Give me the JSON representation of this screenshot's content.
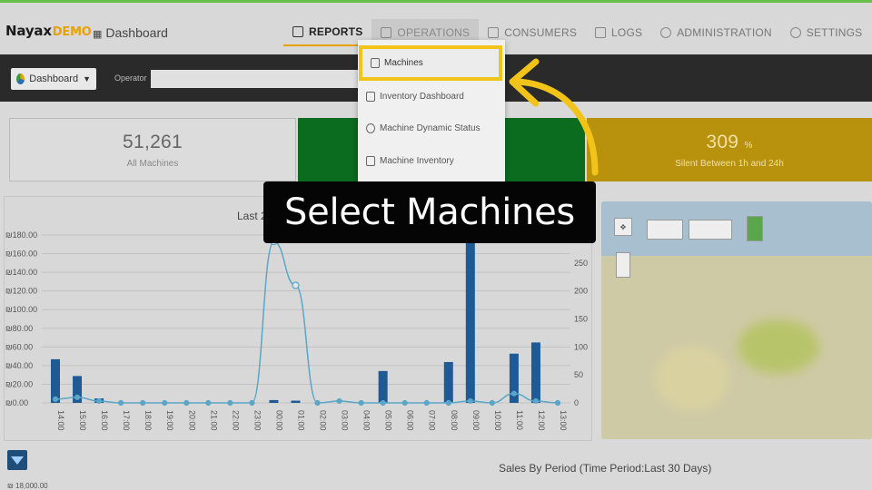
{
  "header": {
    "logo_main": "Nayax",
    "logo_sub": "DEMO",
    "page_name": "Dashboard",
    "nav": [
      {
        "label": "REPORTS",
        "state": "active"
      },
      {
        "label": "OPERATIONS",
        "state": "open"
      },
      {
        "label": "CONSUMERS",
        "state": "normal"
      },
      {
        "label": "LOGS",
        "state": "normal"
      },
      {
        "label": "ADMINISTRATION",
        "state": "normal"
      },
      {
        "label": "SETTINGS",
        "state": "normal"
      }
    ]
  },
  "filter": {
    "dashboard_select": "Dashboard",
    "operator_label": "Operator",
    "operator_value": ""
  },
  "kpis": [
    {
      "value": "51,261",
      "label": "All Machines"
    },
    {
      "value": "",
      "label": ""
    },
    {
      "value": "309",
      "unit": "%",
      "label": "Silent Between 1h and 24h"
    }
  ],
  "dropdown": {
    "items": [
      "Machines",
      "Inventory Dashboard",
      "Machine Dynamic Status",
      "Machine Inventory"
    ],
    "selected": "Machines"
  },
  "chart_data": {
    "type": "bar",
    "title": "Last 2",
    "categories": [
      "14:00",
      "15:00",
      "16:00",
      "17:00",
      "18:00",
      "19:00",
      "20:00",
      "21:00",
      "22:00",
      "23:00",
      "00:00",
      "01:00",
      "02:00",
      "03:00",
      "04:00",
      "05:00",
      "06:00",
      "07:00",
      "08:00",
      "09:00",
      "10:00",
      "11:00",
      "12:00",
      "13:00"
    ],
    "left_axis": {
      "ticks": [
        "₪0.00",
        "₪20.00",
        "₪40.00",
        "₪60.00",
        "₪80.00",
        "₪100.00",
        "₪120.00",
        "₪140.00",
        "₪160.00",
        "₪180.00"
      ],
      "range": [
        0,
        180
      ]
    },
    "right_axis": {
      "ticks": [
        "0",
        "50",
        "100",
        "150",
        "200",
        "250",
        "300"
      ],
      "range": [
        0,
        300
      ]
    },
    "series": [
      {
        "type": "bar",
        "axis": "right",
        "values": [
          78,
          48,
          8,
          0,
          0,
          0,
          0,
          0,
          0,
          0,
          5,
          4,
          0,
          0,
          0,
          57,
          0,
          0,
          73,
          300,
          0,
          88,
          108,
          0
        ]
      },
      {
        "type": "line",
        "axis": "left",
        "values": [
          4,
          6,
          2,
          0,
          0,
          0,
          0,
          0,
          0,
          0,
          173,
          126,
          0,
          2,
          0,
          0,
          0,
          0,
          0,
          2,
          0,
          10,
          2,
          0
        ]
      }
    ],
    "colors": {
      "bar": "#1f5a94",
      "line": "#5aa6c8"
    }
  },
  "sales_period": {
    "title": "Sales By Period (Time Period:Last 30 Days)",
    "first_tick": "₪ 18,000.00"
  },
  "overlay": {
    "caption": "Select Machines",
    "arrow_color": "#f2c318"
  }
}
